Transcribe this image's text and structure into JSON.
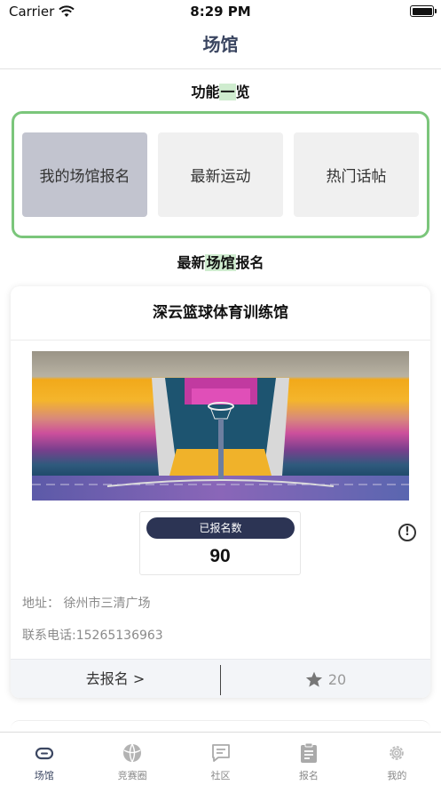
{
  "status": {
    "carrier": "Carrier",
    "time": "8:29 PM"
  },
  "nav": {
    "title": "场馆"
  },
  "functions": {
    "title_pre": "功能",
    "title_hl": "一",
    "title_post": "览",
    "items": [
      "我的场馆报名",
      "最新运动",
      "热门话帖"
    ]
  },
  "latest": {
    "title_pre": "最新",
    "title_hl": "场馆",
    "title_post": "报名"
  },
  "venue": {
    "name": "深云篮球体育训练馆",
    "count_label": "已报名数",
    "count": "90",
    "address": "地址：  徐州市三清广场",
    "phone": "联系电话:15265136963",
    "signup": "去报名 >",
    "stars": "20"
  },
  "tabs": [
    "场馆",
    "竞赛圈",
    "社区",
    "报名",
    "我的"
  ],
  "colors": {
    "accent": "#3b4661",
    "highlight": "#7bc67b",
    "label_bg": "#2c3454"
  }
}
